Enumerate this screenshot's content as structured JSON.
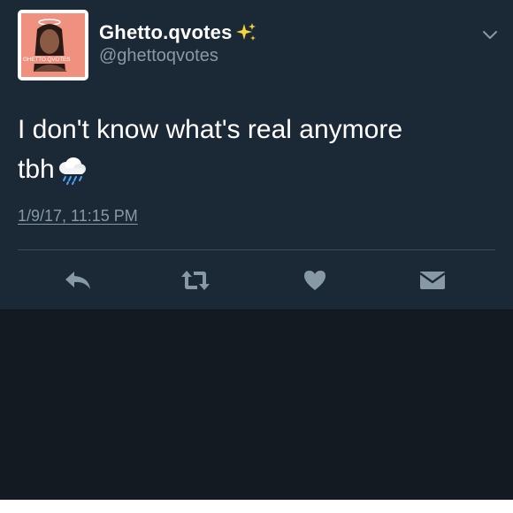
{
  "tweet": {
    "display_name": "Ghetto.qvotes",
    "handle": "@ghettoqvotes",
    "avatar_caption": "GHETTO QVOTES",
    "text_line1": "I don't know what's real anymore",
    "text_line2": "tbh",
    "timestamp": "1/9/17, 11:15 PM"
  },
  "icons": {
    "name_badge": "sparkles-icon",
    "text_emoji": "rain-cloud-icon",
    "menu": "chevron-down-icon",
    "actions": [
      "reply-icon",
      "retweet-icon",
      "heart-icon",
      "direct-message-icon"
    ]
  },
  "colors": {
    "card_background": "#1b2836",
    "page_background": "#141a22",
    "primary_text": "#ffffff",
    "secondary_text": "#8899a6",
    "icon_gray": "#8899a6"
  }
}
